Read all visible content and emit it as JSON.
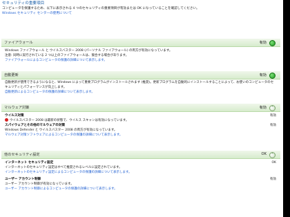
{
  "intro": {
    "title": "セキュリティの重要項目",
    "description": "コンピュータを保護するため、以下に表示される 4 つのセキュリティの重要項目が有効または OK になっていることを確認してください。",
    "link": "Windows セキュリティ センターの使用について"
  },
  "sections": {
    "firewall": {
      "title": "ファイアウォール",
      "status": "有効",
      "line1": "Windows ファイアウォール と ウイルスバスター 2008 (パーソナル ファイアウォール) の両方が有効になっています。",
      "line2": "注意: 同時に実行されている 2 つ以上のファイアウォールは、競合する場合があります。",
      "link": "ファイアウォールによるコンピュータの保護の詳細について表示します。"
    },
    "autoupdate": {
      "title": "自動更新",
      "status": "有効",
      "line1": "自動更新が使用できるようになると、Windows によって重要プログラムがインストールされます (推奨)。更新プログラムを自動的にインストールすることによって、お使いのコンピュータのセキュリティとパフォーマンスが向上します。",
      "link": "自動更新によるコンピュータの保護の詳細について表示します。"
    },
    "malware": {
      "title": "マルウェア対策",
      "status": "有効",
      "virus_title": "ウイルス対策",
      "virus_status": "有効",
      "virus_line": "ウイルスバスター 2008 は最新の状態で、ウイルス スキャンは有効になっています。",
      "spyware_title": "スパイウェアとその他のマルウェアの対策",
      "spyware_status": "有効",
      "spyware_line": "Windows Defender と ウイルスバスター 2008 の両方が有効になっています。",
      "link": "マルウェア対策ソフトウェアによるコンピュータの保護の詳細について表示します。"
    },
    "other": {
      "title": "他のセキュリティ設定",
      "status": "OK",
      "inet_title": "インターネット セキュリティ設定",
      "inet_status": "OK",
      "inet_line": "インターネットのセキュリティ設定はすべて推奨されるレベルに設定されています。",
      "inet_link": "インターネットのセキュリティ設定によるコンピュータの保護の詳細について表示します。",
      "uac_title": "ユーザー アカウント制御",
      "uac_status": "有効",
      "uac_line": "ユーザー アカウント制御が有効になっています。",
      "uac_link": "ユーザー アカウント制御によるコンピュータの保護の詳細について表示します。"
    }
  },
  "colors": {
    "header_gradient_top": "#eff7ea",
    "header_gradient_bottom": "#d7eccd",
    "link": "#1f5fd1",
    "ok_green": "#1d9a1d",
    "warning_red": "#d62020"
  },
  "icons": {
    "section_ok": "green-check-circle-icon",
    "section_expand": "chevron-circle-icon",
    "virus_status": "red-warning-icon"
  }
}
